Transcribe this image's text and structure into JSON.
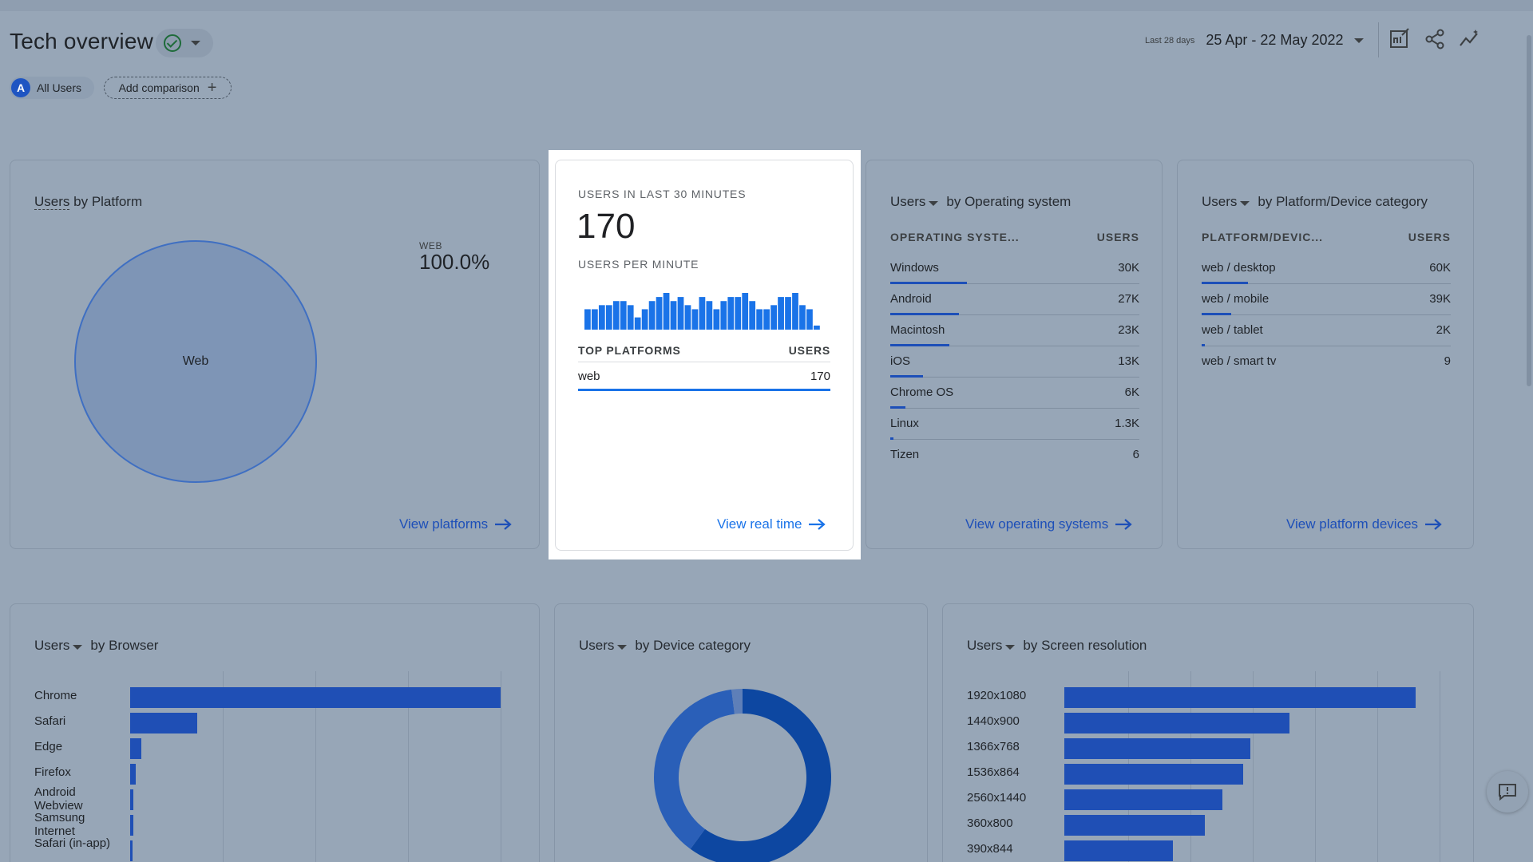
{
  "header": {
    "title": "Tech overview",
    "date_label": "Last 28 days",
    "date_range": "25 Apr - 22 May 2022"
  },
  "comparison": {
    "avatar_letter": "A",
    "segment": "All Users",
    "add_label": "Add comparison"
  },
  "platform_card": {
    "title_metric": "Users",
    "title_dim": "by Platform",
    "legend_category": "WEB",
    "legend_value": "100.0%",
    "pie_label": "Web",
    "link": "View platforms",
    "chart_data": {
      "type": "pie",
      "categories": [
        "Web"
      ],
      "values": [
        100.0
      ]
    }
  },
  "realtime_card": {
    "users_label": "USERS IN LAST 30 MINUTES",
    "users_value": "170",
    "per_minute_label": "USERS PER MINUTE",
    "platforms_header": "TOP PLATFORMS",
    "users_header": "USERS",
    "row_name": "web",
    "row_value": "170",
    "link": "View real time",
    "chart_data": {
      "type": "bar",
      "values": [
        5,
        5,
        6,
        6,
        7,
        7,
        6,
        3,
        5,
        7,
        8,
        9,
        7,
        8,
        6,
        5,
        8,
        7,
        5,
        7,
        8,
        8,
        9,
        7,
        5,
        5,
        6,
        8,
        8,
        9,
        6,
        5,
        1
      ]
    }
  },
  "os_card": {
    "title_metric": "Users",
    "title_dim": "by Operating system",
    "col1": "OPERATING SYSTE...",
    "col2": "USERS",
    "rows": [
      {
        "name": "Windows",
        "value": "30K",
        "share": 1.0
      },
      {
        "name": "Android",
        "value": "27K",
        "share": 0.9
      },
      {
        "name": "Macintosh",
        "value": "23K",
        "share": 0.77
      },
      {
        "name": "iOS",
        "value": "13K",
        "share": 0.43
      },
      {
        "name": "Chrome OS",
        "value": "6K",
        "share": 0.2
      },
      {
        "name": "Linux",
        "value": "1.3K",
        "share": 0.04
      },
      {
        "name": "Tizen",
        "value": "6",
        "share": 0.0
      }
    ],
    "link": "View operating systems"
  },
  "device_card": {
    "title_metric": "Users",
    "title_dim": "by Platform/Device category",
    "col1": "PLATFORM/DEVIC...",
    "col2": "USERS",
    "rows": [
      {
        "name": "web / desktop",
        "value": "60K",
        "share": 0.6
      },
      {
        "name": "web / mobile",
        "value": "39K",
        "share": 0.39
      },
      {
        "name": "web / tablet",
        "value": "2K",
        "share": 0.02
      },
      {
        "name": "web / smart tv",
        "value": "9",
        "share": 0.0
      }
    ],
    "link": "View platform devices"
  },
  "browser_card": {
    "title_metric": "Users",
    "title_dim": "by Browser",
    "chart_data": {
      "type": "bar",
      "categories": [
        "Chrome",
        "Safari",
        "Edge",
        "Firefox",
        "Android Webview",
        "Samsung Internet",
        "Safari (in-app)"
      ],
      "values": [
        1.0,
        0.18,
        0.03,
        0.015,
        0.008,
        0.008,
        0.005
      ]
    }
  },
  "devcat_card": {
    "title_metric": "Users",
    "title_dim": "by Device category",
    "chart_data": {
      "type": "pie",
      "values": [
        0.6,
        0.38,
        0.02
      ]
    }
  },
  "screen_card": {
    "title_metric": "Users",
    "title_dim": "by Screen resolution",
    "chart_data": {
      "type": "bar",
      "categories": [
        "1920x1080",
        "1440x900",
        "1366x768",
        "1536x864",
        "2560x1440",
        "360x800",
        "390x844"
      ],
      "values": [
        1.0,
        0.64,
        0.53,
        0.51,
        0.45,
        0.4,
        0.31
      ]
    }
  }
}
